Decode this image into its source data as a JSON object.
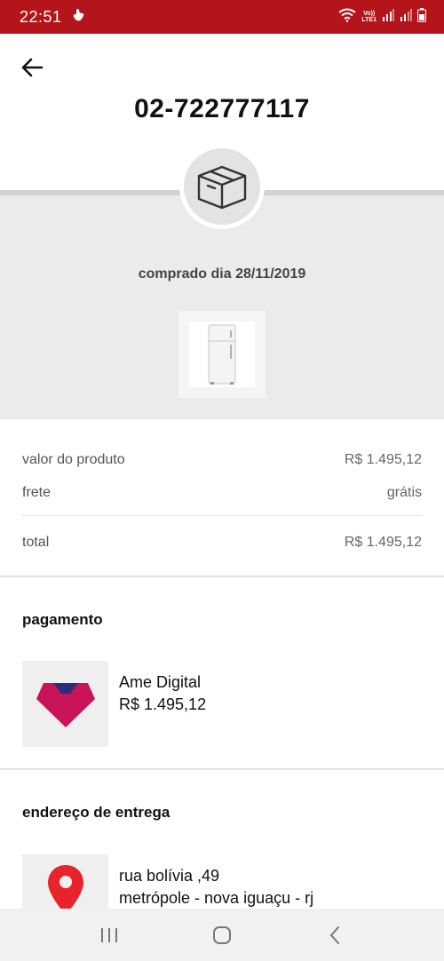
{
  "status_bar": {
    "time": "22:51",
    "volte_top": "Vo))",
    "volte_bottom": "LTE1"
  },
  "header": {
    "order_number": "02-722777117"
  },
  "order": {
    "purchased_text": "comprado dia 28/11/2019"
  },
  "summary": {
    "product_label": "valor do produto",
    "product_value": "R$ 1.495,12",
    "shipping_label": "frete",
    "shipping_value": "grátis",
    "total_label": "total",
    "total_value": "R$ 1.495,12"
  },
  "payment": {
    "title": "pagamento",
    "method": "Ame Digital",
    "amount": "R$ 1.495,12"
  },
  "address": {
    "title": "endereço de entrega",
    "line1": "rua bolívia ,49",
    "line2": "metrópole - nova iguaçu - rj"
  },
  "colors": {
    "status_bar": "#b4151b",
    "ame_brand": "#c8155a",
    "pin": "#e8232b"
  },
  "icons": [
    "back-arrow-icon",
    "box-icon",
    "refrigerator-image",
    "ame-logo-icon",
    "location-pin-icon",
    "recent-apps-icon",
    "home-icon",
    "back-chevron-icon"
  ]
}
